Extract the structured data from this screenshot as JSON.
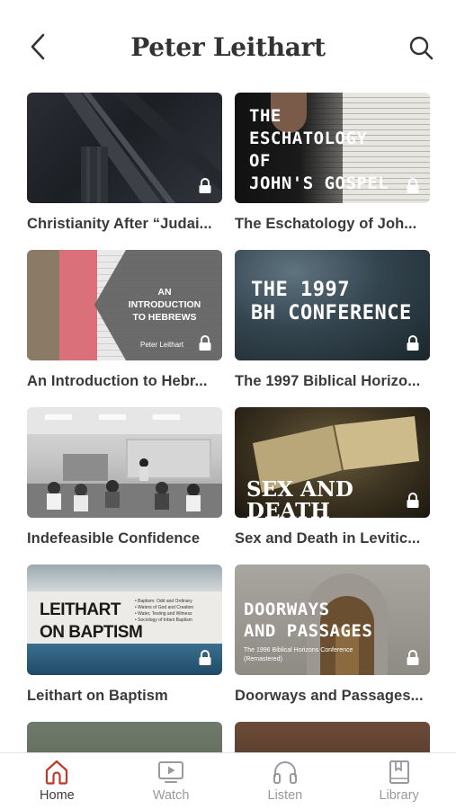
{
  "header": {
    "title": "Peter Leithart",
    "back_icon": "chevron-left-icon",
    "search_icon": "search-icon"
  },
  "cards": [
    {
      "title": "Christianity After “Judai...",
      "thumb_text": "",
      "locked": true
    },
    {
      "title": "The Eschatology of Joh...",
      "thumb_text": "THE\nESCHATOLOGY\nOF\nJOHN'S GOSPEL",
      "locked": true
    },
    {
      "title": "An Introduction to Hebr...",
      "thumb_text": "AN\nINTRODUCTION\nTO HEBREWS",
      "thumb_sub": "Peter Leithart",
      "locked": true
    },
    {
      "title": "The 1997 Biblical Horizo...",
      "thumb_text": "THE 1997\nBH CONFERENCE",
      "locked": true
    },
    {
      "title": "Indefeasible Confidence",
      "thumb_text": "",
      "locked": false
    },
    {
      "title": "Sex and Death in Levitic...",
      "thumb_text": "SEX AND\nDEATH",
      "locked": true
    },
    {
      "title": "Leithart on Baptism",
      "thumb_text": "LEITHART\nON BAPTISM",
      "thumb_sub": "• Baptism: Odd and Ordinary\n• Waters of God and Creation\n• Water, Testing and Witness\n• Sociology of Infant Baptism",
      "locked": true
    },
    {
      "title": "Doorways and Passages...",
      "thumb_text": "DOORWAYS\nAND PASSAGES",
      "thumb_sub": "The 1996 Biblical Horizons Conference\n(Remastered)",
      "locked": true
    }
  ],
  "tabs": [
    {
      "label": "Home",
      "icon": "home-icon",
      "active": true
    },
    {
      "label": "Watch",
      "icon": "play-icon",
      "active": false
    },
    {
      "label": "Listen",
      "icon": "headphones-icon",
      "active": false
    },
    {
      "label": "Library",
      "icon": "bookmark-book-icon",
      "active": false
    }
  ],
  "colors": {
    "accent": "#c0392b",
    "inactive": "#9a9a9a",
    "text": "#3a3a3a"
  }
}
